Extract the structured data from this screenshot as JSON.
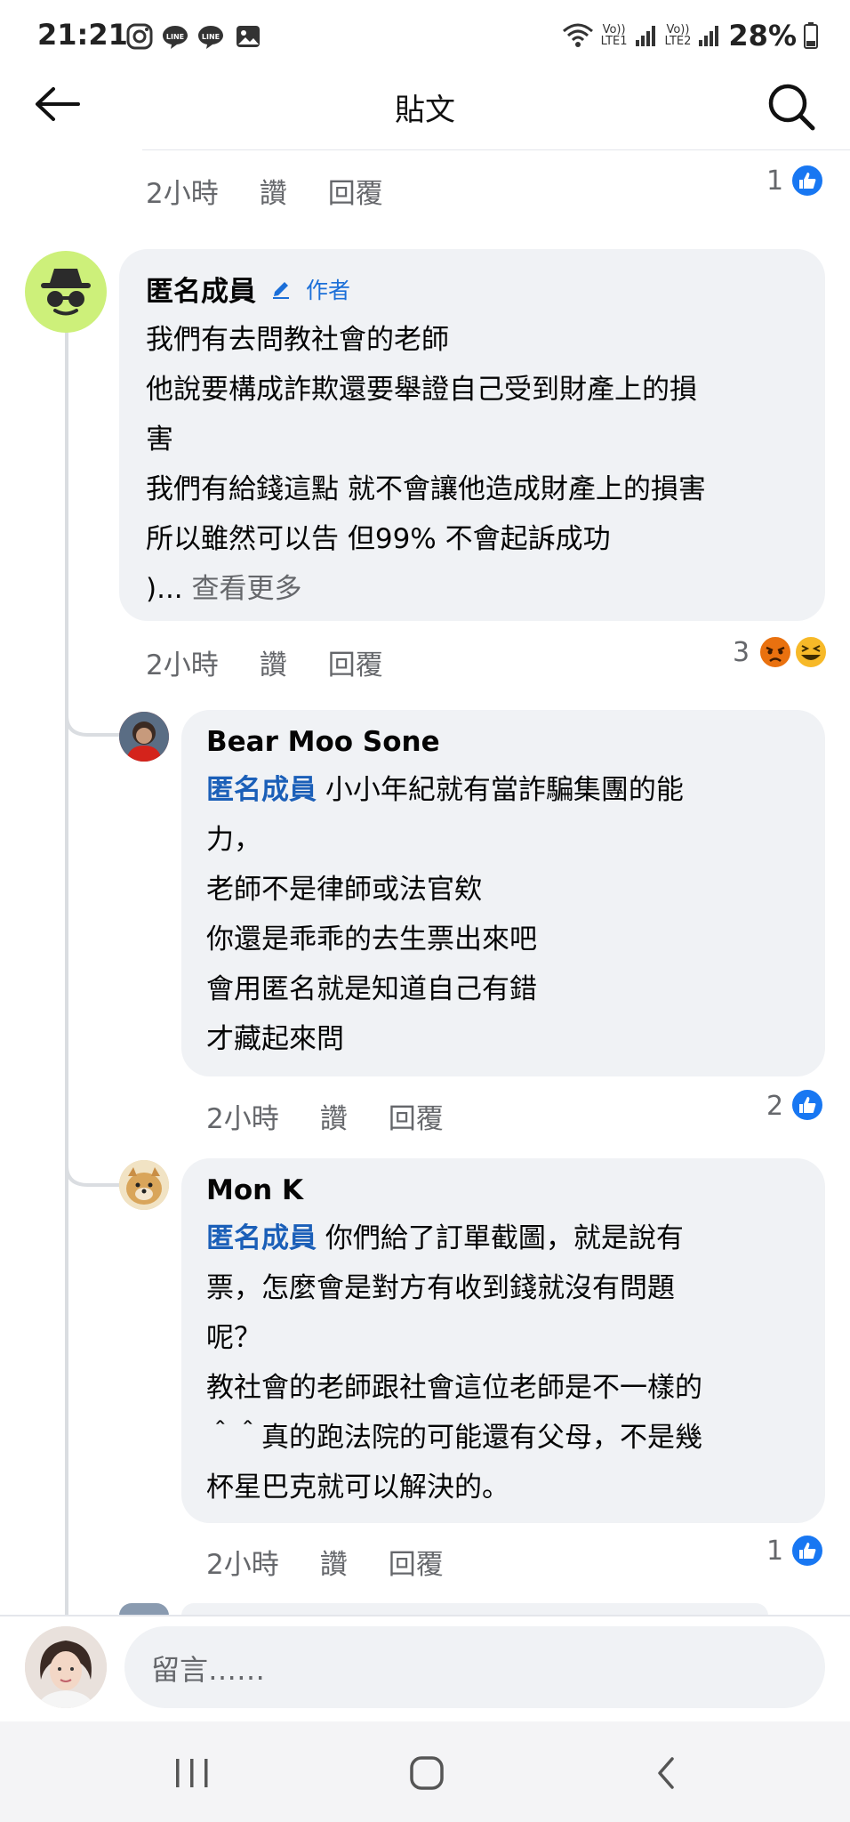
{
  "status_bar": {
    "time": "21:21",
    "battery": "28%",
    "sim1": "LTE1",
    "sim2": "LTE2",
    "volte": "Vo))"
  },
  "app_bar": {
    "title": "貼文",
    "back_icon": "arrow-left-icon",
    "search_icon": "search-icon"
  },
  "comments": [
    {
      "meta": {
        "time": "2小時",
        "like": "讚",
        "reply": "回覆",
        "reactions": "1"
      }
    },
    {
      "author": "匿名成員",
      "author_badge": "作者",
      "lines": [
        "我們有去問教社會的老師",
        "他說要構成詐欺還要舉證自己受到財產上的損",
        "害",
        "我們有給錢這點 就不會讓他造成財產上的損害",
        "所以雖然可以告 但99% 不會起訴成功"
      ],
      "truncated": ")...",
      "see_more": "查看更多",
      "meta": {
        "time": "2小時",
        "like": "讚",
        "reply": "回覆",
        "reactions": "3"
      }
    },
    {
      "author": "Bear Moo Sone",
      "mention": "匿名成員",
      "first_line_rest": " 小小年紀就有當詐騙集團的能",
      "lines": [
        "力，",
        "老師不是律師或法官欸",
        "你還是乖乖的去生票出來吧",
        "會用匿名就是知道自己有錯",
        "才藏起來問"
      ],
      "meta": {
        "time": "2小時",
        "like": "讚",
        "reply": "回覆",
        "reactions": "2"
      }
    },
    {
      "author": "Mon K",
      "mention": "匿名成員",
      "first_line_rest": " 你們給了訂單截圖，就是說有",
      "lines": [
        "票，怎麼會是對方有收到錢就沒有問題",
        "呢？",
        "教社會的老師跟社會這位老師是不一樣的",
        "＾＾真的跑法院的可能還有父母，不是幾",
        "杯星巴克就可以解決的。"
      ],
      "meta": {
        "time": "2小時",
        "like": "讚",
        "reply": "回覆",
        "reactions": "1"
      }
    }
  ],
  "comment_input": {
    "placeholder": "留言……"
  },
  "colors": {
    "like_blue": "#1877f2",
    "bubble_bg": "#f0f2f5",
    "mention": "#1b5fb8",
    "anon_avatar": "#cdf07a"
  },
  "nav": {
    "recents_icon": "recents-icon",
    "home_icon": "home-icon",
    "back_icon": "nav-back-icon"
  }
}
